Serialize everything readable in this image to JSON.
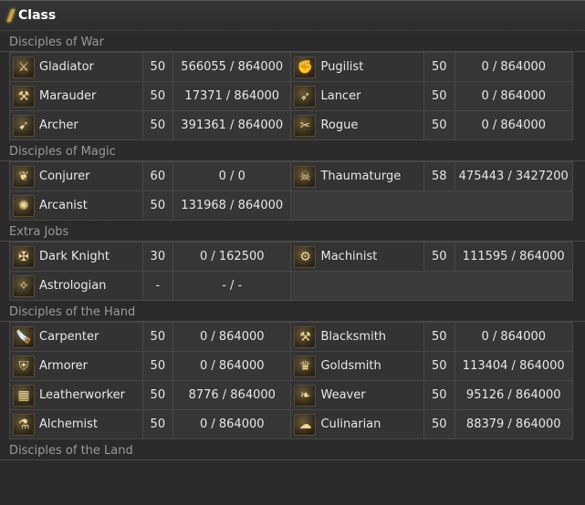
{
  "window": {
    "title": "Class"
  },
  "sections": [
    {
      "header": "Disciples of War",
      "rows": [
        [
          {
            "name": "Gladiator",
            "icon": "gladiator-icon",
            "glyph": "⚔",
            "level": "50",
            "exp": "566055 / 864000"
          },
          {
            "name": "Pugilist",
            "icon": "pugilist-icon",
            "glyph": "✊",
            "level": "50",
            "exp": "0 / 864000"
          }
        ],
        [
          {
            "name": "Marauder",
            "icon": "marauder-icon",
            "glyph": "⚒",
            "level": "50",
            "exp": "17371 / 864000"
          },
          {
            "name": "Lancer",
            "icon": "lancer-icon",
            "glyph": "➶",
            "level": "50",
            "exp": "0 / 864000"
          }
        ],
        [
          {
            "name": "Archer",
            "icon": "archer-icon",
            "glyph": "➹",
            "level": "50",
            "exp": "391361 / 864000"
          },
          {
            "name": "Rogue",
            "icon": "rogue-icon",
            "glyph": "✂",
            "level": "50",
            "exp": "0 / 864000"
          }
        ]
      ]
    },
    {
      "header": "Disciples of Magic",
      "rows": [
        [
          {
            "name": "Conjurer",
            "icon": "conjurer-icon",
            "glyph": "❦",
            "level": "60",
            "exp": "0 / 0"
          },
          {
            "name": "Thaumaturge",
            "icon": "thaumaturge-icon",
            "glyph": "☠",
            "level": "58",
            "exp": "475443 / 3427200"
          }
        ],
        [
          {
            "name": "Arcanist",
            "icon": "arcanist-icon",
            "glyph": "✺",
            "level": "50",
            "exp": "131968 / 864000"
          },
          null
        ]
      ]
    },
    {
      "header": "Extra Jobs",
      "rows": [
        [
          {
            "name": "Dark Knight",
            "icon": "dark-knight-icon",
            "glyph": "✠",
            "level": "30",
            "exp": "0 / 162500"
          },
          {
            "name": "Machinist",
            "icon": "machinist-icon",
            "glyph": "⚙",
            "level": "50",
            "exp": "111595 / 864000"
          }
        ],
        [
          {
            "name": "Astrologian",
            "icon": "astrologian-icon",
            "glyph": "✧",
            "level": "-",
            "exp": "- / -"
          },
          null
        ]
      ]
    },
    {
      "header": "Disciples of the Hand",
      "rows": [
        [
          {
            "name": "Carpenter",
            "icon": "carpenter-icon",
            "glyph": "🪚",
            "level": "50",
            "exp": "0 / 864000"
          },
          {
            "name": "Blacksmith",
            "icon": "blacksmith-icon",
            "glyph": "⚒",
            "level": "50",
            "exp": "0 / 864000"
          }
        ],
        [
          {
            "name": "Armorer",
            "icon": "armorer-icon",
            "glyph": "⛨",
            "level": "50",
            "exp": "0 / 864000"
          },
          {
            "name": "Goldsmith",
            "icon": "goldsmith-icon",
            "glyph": "♛",
            "level": "50",
            "exp": "113404 / 864000"
          }
        ],
        [
          {
            "name": "Leatherworker",
            "icon": "leatherworker-icon",
            "glyph": "▦",
            "level": "50",
            "exp": "8776 / 864000"
          },
          {
            "name": "Weaver",
            "icon": "weaver-icon",
            "glyph": "❧",
            "level": "50",
            "exp": "95126 / 864000"
          }
        ],
        [
          {
            "name": "Alchemist",
            "icon": "alchemist-icon",
            "glyph": "⚗",
            "level": "50",
            "exp": "0 / 864000"
          },
          {
            "name": "Culinarian",
            "icon": "culinarian-icon",
            "glyph": "☁",
            "level": "50",
            "exp": "88379 / 864000"
          }
        ]
      ]
    },
    {
      "header": "Disciples of the Land",
      "rows": []
    }
  ],
  "colors": {
    "accent": "#c9a23a",
    "header_text": "#9a9a9a",
    "cell_text": "#e8e8e8"
  }
}
